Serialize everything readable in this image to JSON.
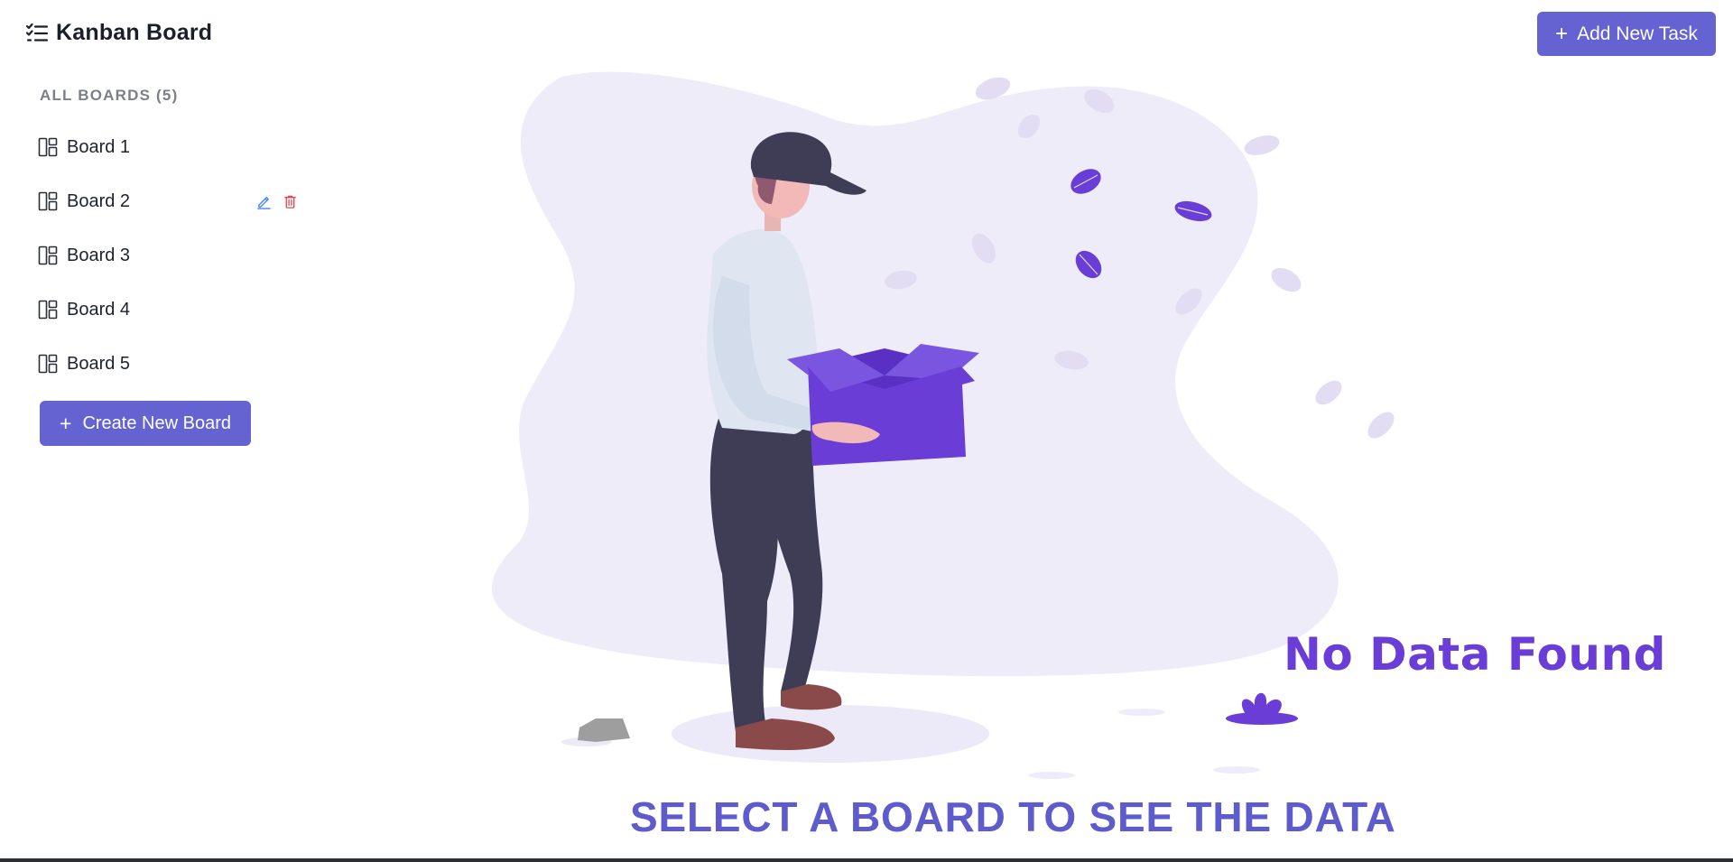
{
  "app": {
    "title": "Kanban Board",
    "brand_icon": "checklist-icon",
    "accent_color": "#6563d2",
    "illustration_color": "#6a3ed6"
  },
  "header": {
    "add_task_label": "Add New Task",
    "add_task_icon": "plus-icon"
  },
  "sidebar": {
    "heading": "ALL BOARDS (5)",
    "boards": [
      {
        "label": "Board 1",
        "icon": "board-layout-icon"
      },
      {
        "label": "Board 2",
        "icon": "board-layout-icon",
        "actions": [
          "edit-icon",
          "delete-icon"
        ]
      },
      {
        "label": "Board 3",
        "icon": "board-layout-icon"
      },
      {
        "label": "Board 4",
        "icon": "board-layout-icon"
      },
      {
        "label": "Board 5",
        "icon": "board-layout-icon"
      }
    ],
    "create_board_label": "Create New Board",
    "create_board_icon": "plus-icon"
  },
  "main": {
    "empty_title": "No Data Found",
    "empty_message": "SELECT A BOARD TO SEE THE DATA",
    "illustration": "person-holding-box-illustration"
  }
}
